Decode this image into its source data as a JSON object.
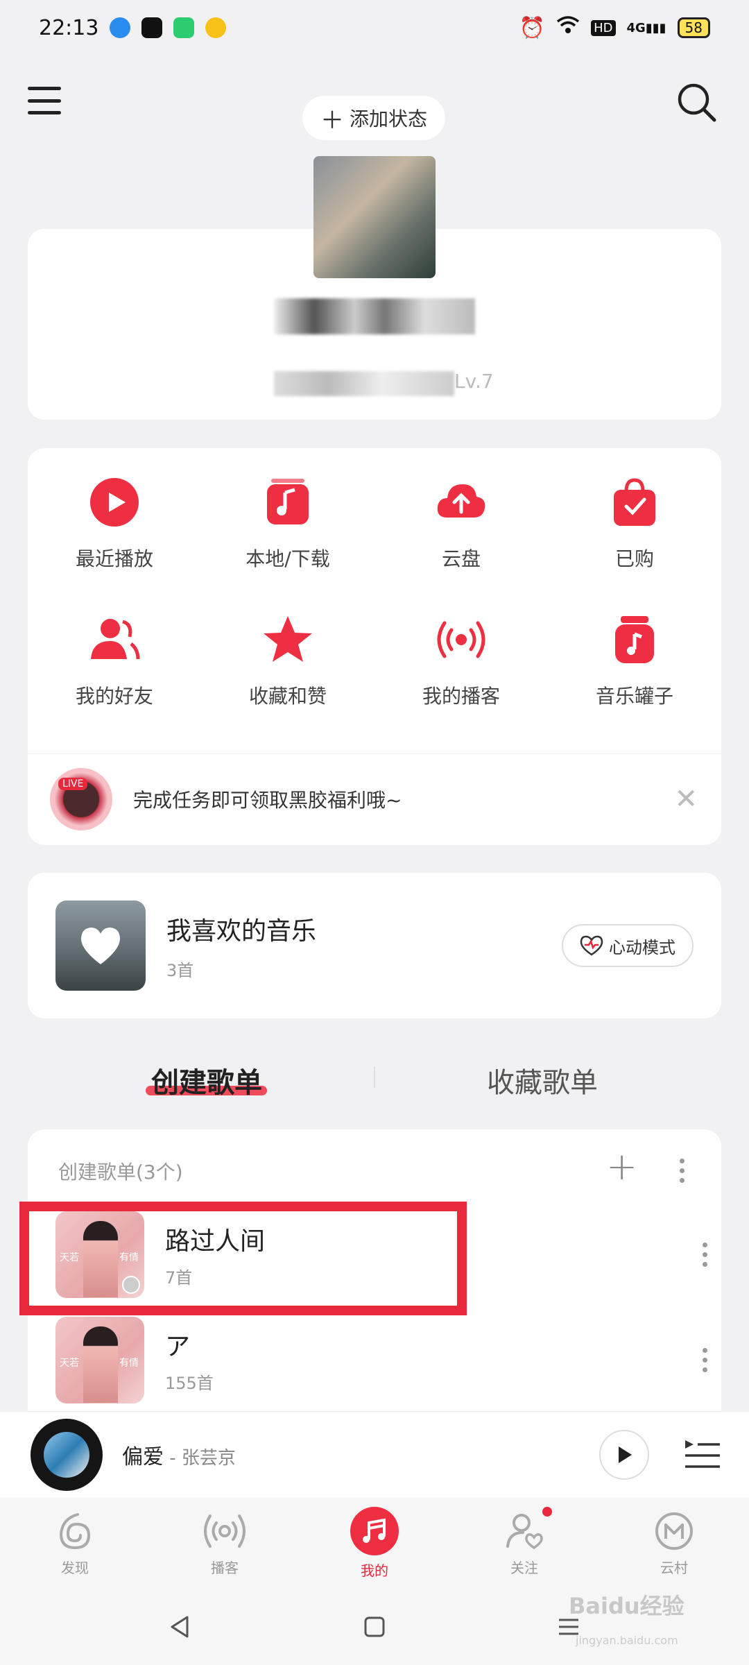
{
  "status_bar": {
    "time": "22:13",
    "battery": "58",
    "network": "4G",
    "hd": "HD"
  },
  "header": {
    "add_status": "添加状态"
  },
  "profile": {
    "level": "Lv.7"
  },
  "shortcuts": [
    {
      "label": "最近播放",
      "icon": "play-circle-icon"
    },
    {
      "label": "本地/下载",
      "icon": "local-music-icon"
    },
    {
      "label": "云盘",
      "icon": "cloud-upload-icon"
    },
    {
      "label": "已购",
      "icon": "purchased-bag-icon"
    },
    {
      "label": "我的好友",
      "icon": "friends-icon"
    },
    {
      "label": "收藏和赞",
      "icon": "star-icon"
    },
    {
      "label": "我的播客",
      "icon": "broadcast-icon"
    },
    {
      "label": "音乐罐子",
      "icon": "music-jar-icon"
    }
  ],
  "banner": {
    "live_tag": "LIVE",
    "text": "完成任务即可领取黑胶福利哦~"
  },
  "liked": {
    "title": "我喜欢的音乐",
    "count": "3首",
    "mode": "心动模式"
  },
  "tabs": {
    "create": "创建歌单",
    "collect": "收藏歌单"
  },
  "playlists": {
    "header": "创建歌单(3个)",
    "items": [
      {
        "title": "路过人间",
        "count": "7首",
        "cover_left": "天若",
        "cover_right": "有情"
      },
      {
        "title": "ア",
        "count": "155首",
        "cover_left": "天若",
        "cover_right": "有情"
      }
    ]
  },
  "player": {
    "song": "偏爱",
    "artist": " - 张芸京"
  },
  "bottom_nav": [
    {
      "label": "发现",
      "icon": "discover-icon"
    },
    {
      "label": "播客",
      "icon": "podcast-icon"
    },
    {
      "label": "我的",
      "icon": "my-music-icon"
    },
    {
      "label": "关注",
      "icon": "follow-icon"
    },
    {
      "label": "云村",
      "icon": "cloud-village-icon"
    }
  ],
  "watermark": {
    "brand": "Baidu经验",
    "url": "jingyan.baidu.com"
  },
  "colors": {
    "accent": "#e8283b",
    "background": "#f1f1f3",
    "card": "#ffffff"
  }
}
